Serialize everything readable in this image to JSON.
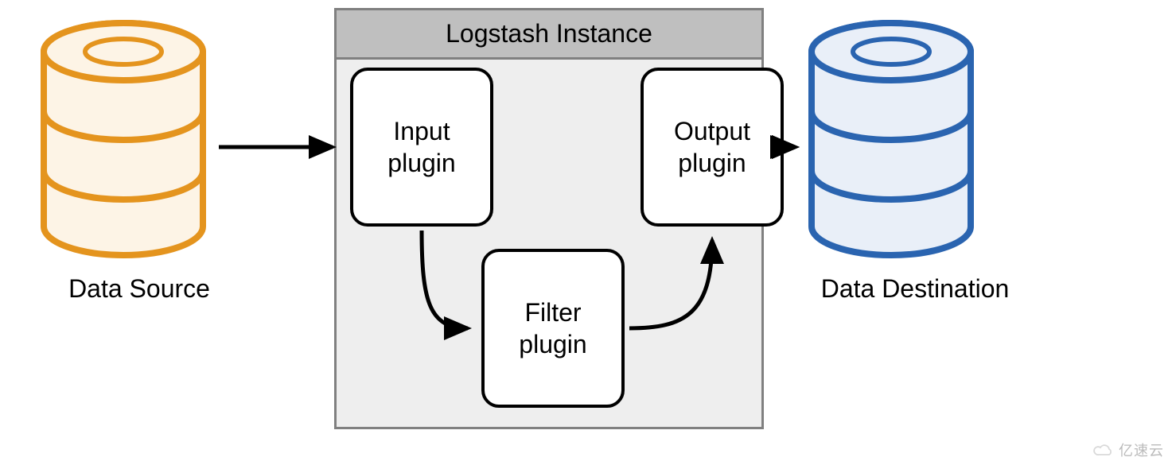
{
  "diagram": {
    "instance_title": "Logstash Instance",
    "plugins": {
      "input": {
        "line1": "Input",
        "line2": "plugin"
      },
      "filter": {
        "line1": "Filter",
        "line2": "plugin"
      },
      "output": {
        "line1": "Output",
        "line2": "plugin"
      }
    },
    "source_label": "Data Source",
    "destination_label": "Data Destination",
    "colors": {
      "source_stroke": "#e4941e",
      "source_fill": "#fdf4e6",
      "destination_stroke": "#2a64b0",
      "destination_fill": "#e9eff8",
      "instance_border": "#808080",
      "instance_body": "#eeeeee",
      "instance_header": "#bfbfbf",
      "plugin_border": "#000000",
      "arrow": "#000000"
    },
    "watermark": "亿速云",
    "flow": [
      {
        "from": "Data Source",
        "to": "Input plugin"
      },
      {
        "from": "Input plugin",
        "to": "Filter plugin"
      },
      {
        "from": "Filter plugin",
        "to": "Output plugin"
      },
      {
        "from": "Output plugin",
        "to": "Data Destination"
      }
    ]
  }
}
